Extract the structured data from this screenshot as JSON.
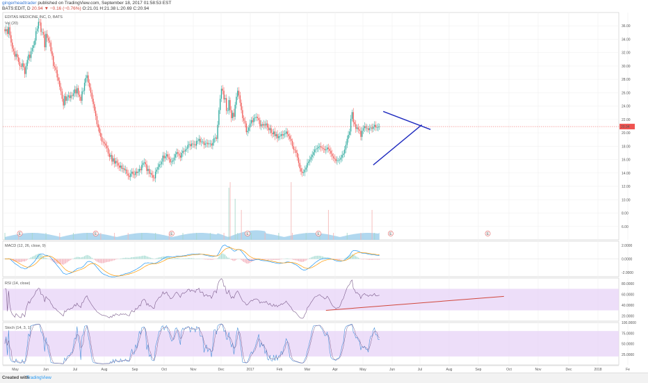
{
  "header": {
    "user": "gingerheadtrader",
    "published": "published on TradingView.com, September 18, 2017 01:58:53 EST",
    "ticker": "BATS:EDIT, D",
    "last": "20.94",
    "change": "▼ −0.16 (−0.76%)",
    "ohlc": "O:21.01 H:21.38 L:20.69 C:20.94"
  },
  "footer": {
    "created_with": "Created with",
    "brand": "TradingView"
  },
  "colors": {
    "up": "#26a69a",
    "down": "#ef5350",
    "volume": "#90c8e8",
    "trendline": "#1f2bbf",
    "rsi_trend": "#d0463b",
    "band": "#e9d6f7",
    "macd": "#2196f3",
    "signal": "#ff9800"
  },
  "chart_data": [
    {
      "type": "candlestick",
      "title": "EDITAS MEDICINE INC, D, BATS",
      "legend": "Vol (20)",
      "last_price_label": "20.94",
      "x_labels": [
        "May",
        "Jun",
        "Jul",
        "Aug",
        "Sep",
        "Oct",
        "Nov",
        "Dec",
        "2017",
        "Feb",
        "Mar",
        "Apr",
        "May",
        "Jun",
        "Jul",
        "Aug",
        "Sep",
        "Oct",
        "Nov",
        "Dec",
        "2018",
        "Fe"
      ],
      "y_ticks": [
        "36.00",
        "34.00",
        "32.00",
        "30.00",
        "28.00",
        "26.00",
        "24.00",
        "22.00",
        "20.00",
        "18.00",
        "16.00",
        "14.00",
        "12.00",
        "10.00",
        "8.00",
        "6.00"
      ],
      "ylim": [
        4,
        38
      ],
      "close": [
        35.2,
        35.5,
        34.8,
        35.8,
        34.6,
        33.5,
        32.6,
        32.2,
        31.4,
        31.8,
        31.3,
        30.6,
        30.0,
        29.9,
        30.4,
        29.8,
        28.8,
        30.0,
        30.9,
        31.7,
        31.2,
        32.2,
        32.7,
        33.1,
        33.8,
        35.2,
        35.6,
        36.6,
        36.5,
        35.1,
        35.1,
        34.7,
        32.8,
        34.8,
        34.2,
        33.8,
        33.5,
        32.2,
        31.5,
        30.0,
        29.8,
        29.4,
        28.3,
        27.8,
        26.9,
        26.2,
        25.1,
        24.1,
        25.5,
        24.8,
        25.4,
        25.6,
        25.2,
        25.6,
        25.5,
        25.9,
        26.5,
        25.9,
        26.7,
        25.7,
        25.4,
        24.8,
        26.2,
        26.3,
        27.5,
        28.2,
        28.6,
        27.5,
        26.8,
        26.0,
        25.1,
        24.3,
        23.3,
        22.5,
        21.3,
        20.8,
        20.0,
        19.4,
        18.7,
        18.6,
        18.4,
        18.1,
        17.7,
        16.9,
        16.4,
        16.7,
        15.7,
        16.2,
        15.4,
        15.8,
        15.5,
        15.1,
        14.8,
        15.1,
        14.6,
        14.7,
        14.4,
        14.5,
        13.9,
        13.6,
        13.4,
        13.9,
        14.2,
        13.8,
        13.7,
        14.2,
        14.0,
        14.2,
        14.6,
        14.4,
        15.2,
        15.5,
        15.6,
        15.3,
        14.3,
        14.6,
        13.9,
        14.0,
        13.7,
        13.3,
        13.2,
        14.2,
        14.5,
        14.9,
        15.3,
        15.3,
        15.7,
        16.6,
        16.2,
        16.5,
        16.8,
        16.3,
        16.1,
        15.6,
        15.7,
        15.9,
        16.3,
        16.8,
        17.1,
        16.9,
        16.6,
        16.3,
        17.0,
        17.3,
        17.2,
        17.5,
        17.6,
        18.2,
        18.3,
        18.0,
        18.4,
        18.3,
        18.3,
        18.1,
        18.8,
        18.8,
        19.1,
        18.6,
        18.7,
        18.7,
        18.2,
        18.4,
        18.5,
        18.3,
        18.4,
        18.4,
        18.1,
        18.5,
        19.2,
        19.3,
        19.1,
        21.2,
        23.4,
        25.1,
        26.6,
        26.3,
        25.0,
        25.2,
        23.3,
        23.3,
        24.9,
        23.4,
        22.2,
        23.0,
        22.4,
        24.2,
        25.4,
        26.3,
        25.6,
        24.5,
        23.4,
        22.2,
        21.8,
        21.4,
        20.1,
        20.3,
        20.8,
        21.4,
        21.9,
        21.6,
        22.2,
        22.3,
        22.4,
        22.2,
        21.9,
        21.0,
        21.3,
        21.1,
        21.3,
        21.1,
        21.4,
        20.8,
        20.4,
        20.7,
        20.0,
        19.8,
        20.2,
        19.5,
        19.8,
        19.2,
        19.5,
        19.5,
        19.8,
        19.6,
        19.8,
        19.9,
        20.2,
        19.8,
        19.5,
        19.1,
        18.8,
        18.0,
        17.5,
        17.4,
        17.0,
        16.3,
        15.5,
        14.7,
        14.2,
        14.0,
        14.1,
        14.5,
        14.8,
        15.5,
        15.7,
        16.0,
        16.4,
        16.7,
        17.1,
        17.5,
        17.6,
        17.7,
        17.9,
        18.0,
        17.8,
        17.7,
        17.6,
        17.4,
        17.5,
        17.8,
        17.6,
        17.3,
        16.9,
        16.5,
        16.2,
        16.1,
        15.8,
        15.9,
        15.9,
        16.0,
        16.3,
        16.7,
        16.9,
        17.5,
        18.2,
        19.1,
        19.7,
        20.2,
        22.1,
        23.1,
        21.6,
        21.3,
        20.6,
        20.8,
        20.5,
        20.3,
        19.4,
        20.3,
        20.7,
        21.0,
        20.7,
        20.7,
        20.4,
        20.7,
        20.8,
        20.6,
        20.9,
        21.2,
        20.8,
        20.8,
        20.9,
        20.94
      ],
      "volume_scale": [
        0.6,
        0.6,
        0.55,
        0.6,
        0.6,
        0.6,
        0.55,
        0.55,
        0.5,
        0.5,
        0.5,
        0.5,
        0.45,
        0.45,
        0.45,
        0.45,
        0.45,
        0.45,
        0.45,
        0.45,
        0.4,
        0.4,
        0.4,
        0.4,
        0.4,
        0.4,
        0.4,
        0.4,
        0.4,
        0.4,
        0.4,
        0.4,
        0.4,
        0.4,
        0.4,
        0.4,
        0.4,
        0.4,
        0.4,
        0.4,
        0.4,
        0.4,
        0.4,
        0.4,
        0.4,
        0.4,
        0.4,
        0.4,
        0.4,
        0.4
      ],
      "events": [
        {
          "label": "E",
          "bar": 12
        },
        {
          "label": "E",
          "bar": 73
        },
        {
          "label": "E",
          "bar": 134
        },
        {
          "label": "E",
          "bar": 195
        },
        {
          "label": "E",
          "bar": 252
        },
        {
          "label": "E",
          "bar": 310
        },
        {
          "label": "E",
          "bar": 388
        }
      ],
      "triangle": {
        "upper_from": [
          304,
          23.2
        ],
        "upper_to": [
          342,
          20.5
        ],
        "lower_from": [
          296,
          15.2
        ],
        "lower_to": [
          335,
          21.2
        ]
      }
    },
    {
      "type": "line",
      "title": "MACD (12, 26, close, 9)",
      "y_ticks": [
        "2.0000",
        "0.0000",
        "-2.0000"
      ],
      "ylim": [
        -2.6,
        2.6
      ],
      "series": [
        {
          "name": "MACD"
        },
        {
          "name": "Signal"
        },
        {
          "name": "Histogram"
        }
      ]
    },
    {
      "type": "line",
      "title": "RSI (14, close)",
      "y_ticks": [
        "80.0000",
        "60.0000",
        "40.0000",
        "20.0000"
      ],
      "ylim": [
        10,
        90
      ],
      "band": [
        30,
        70
      ]
    },
    {
      "type": "line",
      "title": "Stoch (14, 3, 1)",
      "y_ticks": [
        "100.0000",
        "75.0000",
        "50.0000",
        "25.0000"
      ],
      "ylim": [
        0,
        100
      ],
      "band": [
        20,
        80
      ]
    }
  ]
}
